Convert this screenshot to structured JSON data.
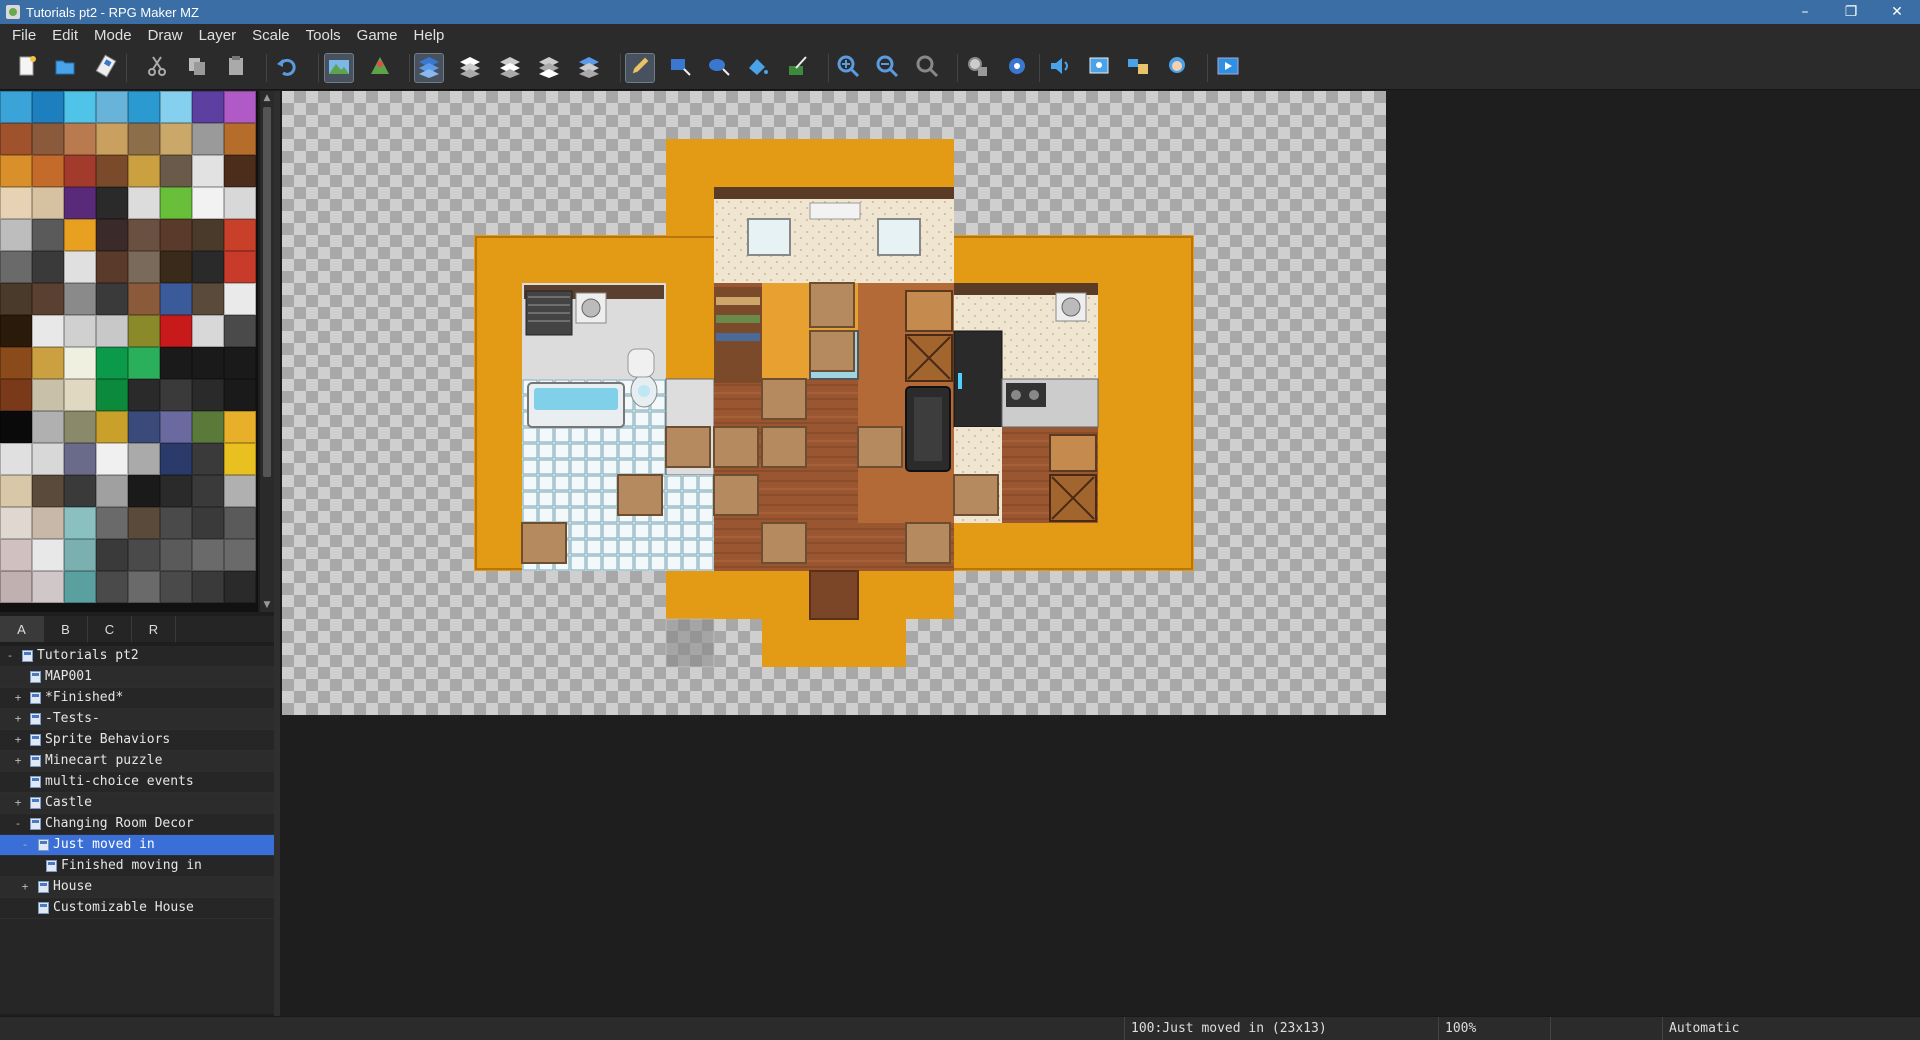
{
  "window": {
    "title": "Tutorials pt2 - RPG Maker MZ",
    "minimize": "–",
    "restore": "❐",
    "close": "✕"
  },
  "menu": [
    "File",
    "Edit",
    "Mode",
    "Draw",
    "Layer",
    "Scale",
    "Tools",
    "Game",
    "Help"
  ],
  "toolbar": {
    "tools": [
      {
        "name": "new-project-icon"
      },
      {
        "name": "open-project-icon"
      },
      {
        "name": "save-project-icon"
      },
      {
        "name": "cut-icon"
      },
      {
        "name": "copy-icon"
      },
      {
        "name": "paste-icon"
      },
      {
        "name": "undo-icon"
      },
      {
        "name": "map-mode-icon",
        "active": true
      },
      {
        "name": "event-mode-icon"
      },
      {
        "name": "layer-auto-icon",
        "active": true
      },
      {
        "name": "layer-1-icon"
      },
      {
        "name": "layer-2-icon"
      },
      {
        "name": "layer-3-icon"
      },
      {
        "name": "layer-4-icon"
      },
      {
        "name": "pencil-icon",
        "active": true
      },
      {
        "name": "rectangle-icon"
      },
      {
        "name": "ellipse-icon"
      },
      {
        "name": "flood-fill-icon"
      },
      {
        "name": "shadow-pen-icon"
      },
      {
        "name": "zoom-in-icon"
      },
      {
        "name": "zoom-out-icon"
      },
      {
        "name": "actual-size-icon"
      },
      {
        "name": "database-icon"
      },
      {
        "name": "plugin-manager-icon"
      },
      {
        "name": "sound-test-icon"
      },
      {
        "name": "event-searcher-icon"
      },
      {
        "name": "resource-manager-icon"
      },
      {
        "name": "character-generator-icon"
      },
      {
        "name": "playtest-icon"
      }
    ]
  },
  "palette_tabs": [
    {
      "label": "A",
      "active": true
    },
    {
      "label": "B"
    },
    {
      "label": "C"
    },
    {
      "label": "R"
    }
  ],
  "map_tree": [
    {
      "label": "Tutorials pt2",
      "depth": 0,
      "expander": "-",
      "root": true
    },
    {
      "label": "MAP001",
      "depth": 1,
      "expander": ""
    },
    {
      "label": "*Finished*",
      "depth": 1,
      "expander": "+"
    },
    {
      "label": "-Tests-",
      "depth": 1,
      "expander": "+"
    },
    {
      "label": "Sprite Behaviors",
      "depth": 1,
      "expander": "+"
    },
    {
      "label": "Minecart puzzle",
      "depth": 1,
      "expander": "+"
    },
    {
      "label": "multi-choice events",
      "depth": 1,
      "expander": ""
    },
    {
      "label": "Castle",
      "depth": 1,
      "expander": "+"
    },
    {
      "label": "Changing Room Decor",
      "depth": 1,
      "expander": "-"
    },
    {
      "label": "Just moved in",
      "depth": 2,
      "expander": "-",
      "selected": true
    },
    {
      "label": "Finished moving in",
      "depth": 3,
      "expander": ""
    },
    {
      "label": "House",
      "depth": 2,
      "expander": "+"
    },
    {
      "label": "Customizable House",
      "depth": 2,
      "expander": ""
    }
  ],
  "status": {
    "map_info": "100:Just moved in (23x13)",
    "zoom": "100%",
    "layer_mode": "Automatic"
  },
  "colors": {
    "accent": "#3a6fd8",
    "title_bar": "#3a6ea5",
    "floor_orange": "#e39a14",
    "wall_cream": "#efe4cc",
    "wood": "#a0592e"
  }
}
